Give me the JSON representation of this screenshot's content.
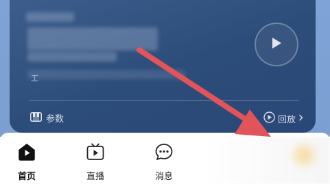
{
  "card": {
    "params_label": "参数",
    "replay_label": "回放",
    "redacted_char": "工"
  },
  "tabs": [
    {
      "label": "首页",
      "icon": "home-icon",
      "active": true
    },
    {
      "label": "直播",
      "icon": "tv-icon",
      "active": false
    },
    {
      "label": "消息",
      "icon": "message-icon",
      "active": false
    }
  ],
  "colors": {
    "card_top": "#3f608f",
    "card_bottom": "#2a4877",
    "band": "#7fa3d6",
    "arrow": "#e0545a"
  },
  "icons": {
    "params": "piano-icon",
    "replay": "replay-icon",
    "replay_chevron": "chevron-right-icon",
    "play": "play-icon",
    "annotation_arrow": "arrow-icon"
  }
}
